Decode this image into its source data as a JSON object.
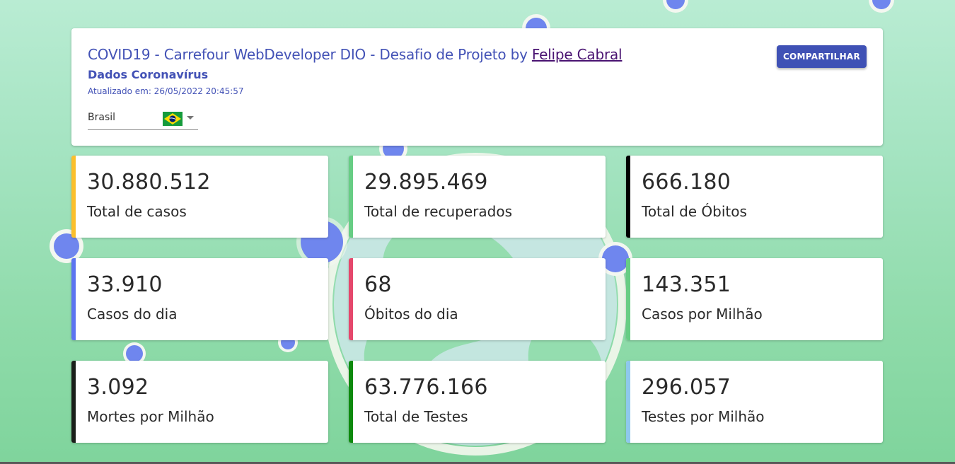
{
  "header": {
    "title_prefix": "COVID19 - Carrefour WebDeveloper DIO - Desafio de Projeto by ",
    "title_link": "Felipe Cabral",
    "subtitle": "Dados Coronavírus",
    "updated": "Atualizado em: 26/05/2022 20:45:57",
    "country": "Brasil",
    "share_label": "COMPARTILHAR"
  },
  "stats": [
    {
      "value": "30.880.512",
      "label": "Total de casos",
      "color": "#fbbf2c"
    },
    {
      "value": "29.895.469",
      "label": "Total de recuperados",
      "color": "#67cd84"
    },
    {
      "value": "666.180",
      "label": "Total de Óbitos",
      "color": "#000000"
    },
    {
      "value": "33.910",
      "label": "Casos do dia",
      "color": "#5c74f0"
    },
    {
      "value": "68",
      "label": "Óbitos do dia",
      "color": "#e5486c"
    },
    {
      "value": "143.351",
      "label": "Casos por Milhão",
      "color": "#67cd84"
    },
    {
      "value": "3.092",
      "label": "Mortes por Milhão",
      "color": "#1a1f1a"
    },
    {
      "value": "63.776.166",
      "label": "Total de Testes",
      "color": "#0d8a0d"
    },
    {
      "value": "296.057",
      "label": "Testes por Milhão",
      "color": "#8ec8ec"
    }
  ],
  "theme": {
    "accent": "#3f51b5",
    "title_color": "#4352b6",
    "link_color": "#4a1472"
  }
}
